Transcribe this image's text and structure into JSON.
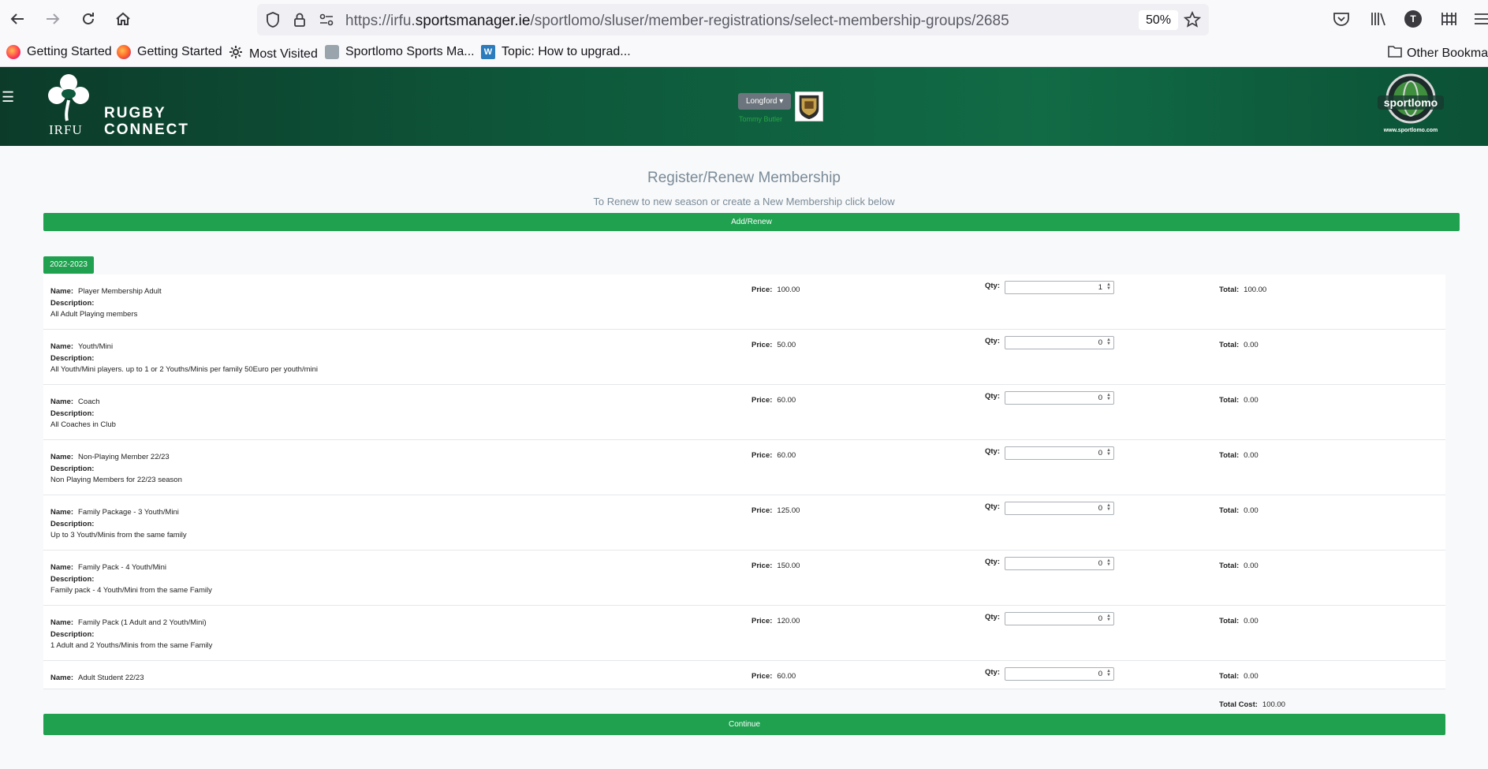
{
  "browser": {
    "url_prefix": "https://irfu.",
    "url_host": "sportsmanager.ie",
    "url_path": "/sportlomo/sluser/member-registrations/select-membership-groups/2685",
    "zoom": "50%",
    "profile_initial": "T",
    "bookmarks": [
      "Getting Started",
      "Getting Started",
      "Most Visited",
      "Sportlomo Sports Ma...",
      "Topic: How to upgrad..."
    ],
    "other_bookmarks": "Other Bookmarks"
  },
  "header": {
    "irfu_text": "IRFU",
    "brand_line1": "RUGBY",
    "brand_line2": "CONNECT",
    "club_select": "Longford",
    "user_name": "Tommy Butler",
    "sportlomo_url": "www.sportlomo.com",
    "colors": {
      "header_dark": "#0c3b2a",
      "accent_green": "#1fa14f"
    }
  },
  "main": {
    "title": "Register/Renew Membership",
    "subtitle": "To Renew to new season or create a New Membership click below",
    "add_renew_label": "Add/Renew",
    "season": "2022-2023",
    "labels": {
      "name": "Name:",
      "description": "Description:",
      "price": "Price:",
      "qty": "Qty:",
      "total": "Total:",
      "total_cost": "Total Cost:"
    },
    "memberships": [
      {
        "name": "Player Membership Adult",
        "description": "All Adult Playing members",
        "price": "100.00",
        "qty": "1",
        "total": "100.00"
      },
      {
        "name": "Youth/Mini",
        "description": "All Youth/Mini players. up to 1 or 2 Youths/Minis per family 50Euro per youth/mini",
        "price": "50.00",
        "qty": "0",
        "total": "0.00"
      },
      {
        "name": "Coach",
        "description": "All Coaches in Club",
        "price": "60.00",
        "qty": "0",
        "total": "0.00"
      },
      {
        "name": "Non-Playing Member 22/23",
        "description": "Non Playing Members for 22/23 season",
        "price": "60.00",
        "qty": "0",
        "total": "0.00"
      },
      {
        "name": "Family Package - 3 Youth/Mini",
        "description": "Up to 3 Youth/Minis from the same family",
        "price": "125.00",
        "qty": "0",
        "total": "0.00"
      },
      {
        "name": "Family Pack - 4 Youth/Mini",
        "description": "Family pack - 4 Youth/Mini from the same Family",
        "price": "150.00",
        "qty": "0",
        "total": "0.00"
      },
      {
        "name": "Family Pack (1 Adult and 2 Youth/Mini)",
        "description": "1 Adult and 2 Youths/Minis from the same Family",
        "price": "120.00",
        "qty": "0",
        "total": "0.00"
      },
      {
        "name": "Adult Student 22/23",
        "description": "",
        "price": "60.00",
        "qty": "0",
        "total": "0.00"
      }
    ],
    "total_cost": "100.00",
    "continue_label": "Continue"
  }
}
